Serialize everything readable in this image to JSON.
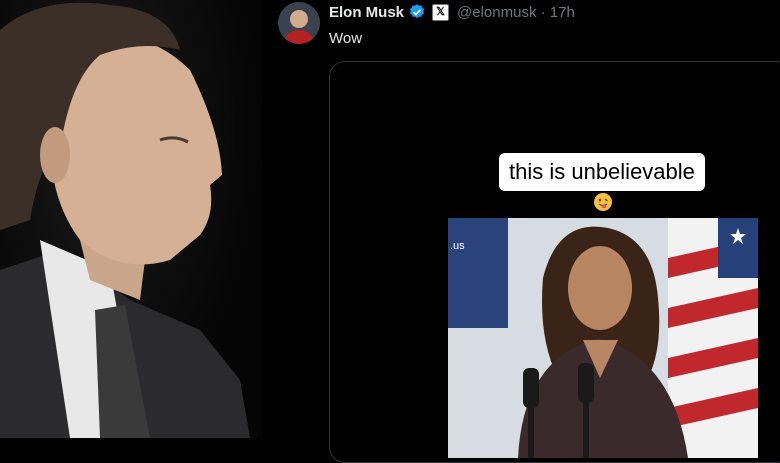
{
  "tweet": {
    "author_name": "Elon Musk",
    "handle_time": "@elonmusk · 17h",
    "text": "Wow",
    "platform_badge": "𝕏",
    "verified_icon": "verified-badge-icon"
  },
  "media": {
    "caption": "this is unbelievable",
    "emoji": "grimacing-tongue-emoji",
    "clip_text": ".us"
  },
  "colors": {
    "background": "#000000",
    "verified": "#1d9bf0",
    "muted_text": "#71767b",
    "border": "#2f3336"
  }
}
